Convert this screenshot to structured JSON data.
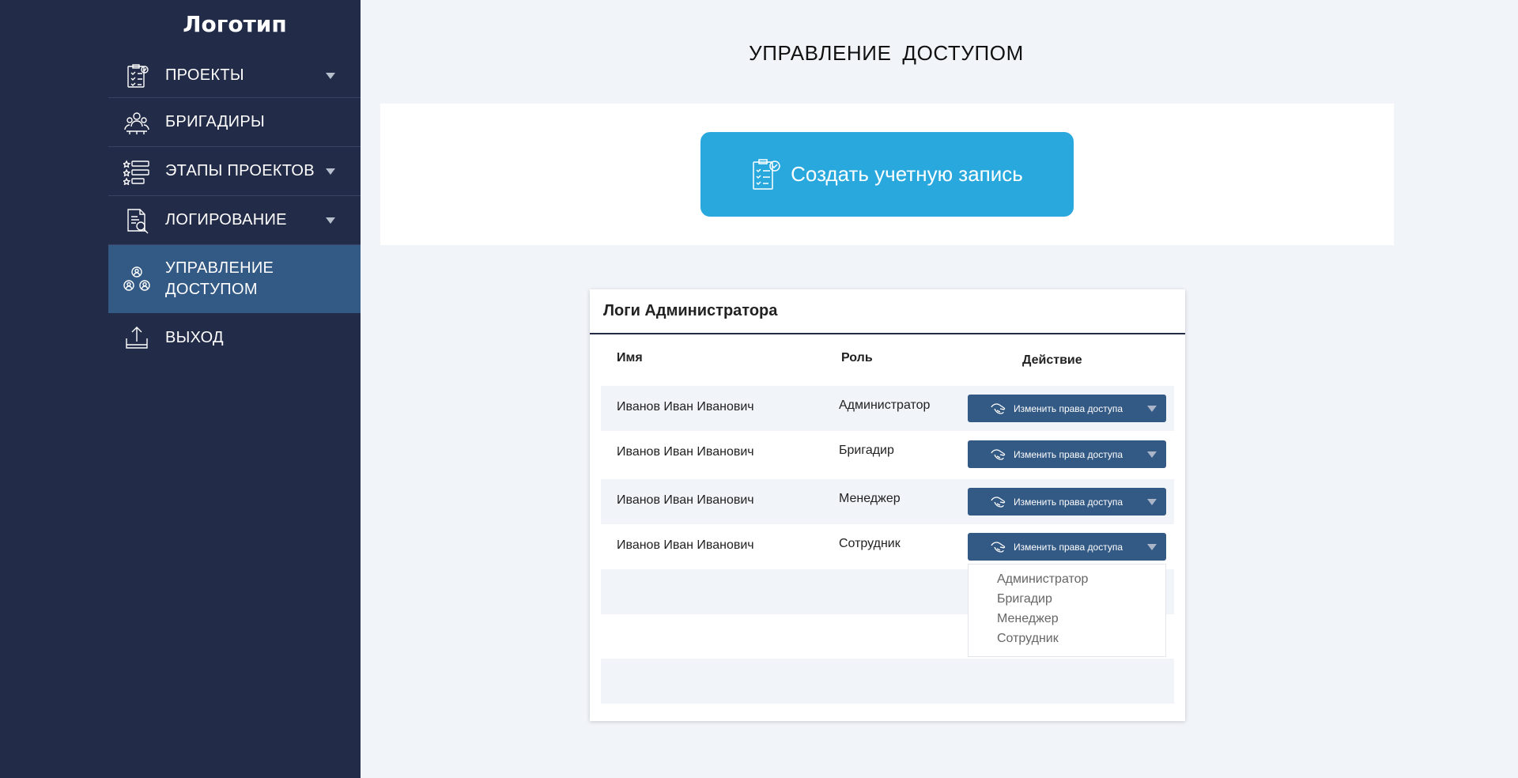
{
  "sidebar": {
    "logo": "Логотип",
    "items": [
      {
        "label": "ПРОЕКТЫ",
        "icon": "clipboard-check-icon"
      },
      {
        "label": "БРИГАДИРЫ",
        "icon": "team-icon"
      },
      {
        "label": "ЭТАПЫ ПРОЕКТОВ",
        "icon": "stages-list-icon"
      },
      {
        "label": "ЛОГИРОВАНИЕ",
        "icon": "log-search-icon"
      },
      {
        "label": "УПРАВЛЕНИЕ\nДОСТУПОМ",
        "icon": "access-users-icon"
      },
      {
        "label": "ВЫХОД",
        "icon": "logout-icon"
      }
    ]
  },
  "main": {
    "title": "УПРАВЛЕНИЕ ДОСТУПОМ",
    "create_button": "Создать учетную запись"
  },
  "table": {
    "title": "Логи Администратора",
    "headers": {
      "name": "Имя",
      "role": "Роль",
      "action": "Действие"
    },
    "rows": [
      {
        "name": "Иванов Иван Иванович",
        "role": "Администратор",
        "action": "Изменить права доступа"
      },
      {
        "name": "Иванов Иван Иванович",
        "role": "Бригадир",
        "action": "Изменить права доступа"
      },
      {
        "name": "Иванов Иван Иванович",
        "role": "Менеджер",
        "action": "Изменить права доступа"
      },
      {
        "name": "Иванов Иван Иванович",
        "role": "Сотрудник",
        "action": "Изменить права доступа"
      }
    ],
    "dropdown_options": [
      "Администратор",
      "Бригадир",
      "Менеджер",
      "Сотрудник"
    ]
  },
  "colors": {
    "sidebar_bg": "#222b48",
    "active_item": "#335985",
    "accent": "#29a8dd",
    "action_button": "#335985",
    "page_bg": "#f1f4f9"
  }
}
